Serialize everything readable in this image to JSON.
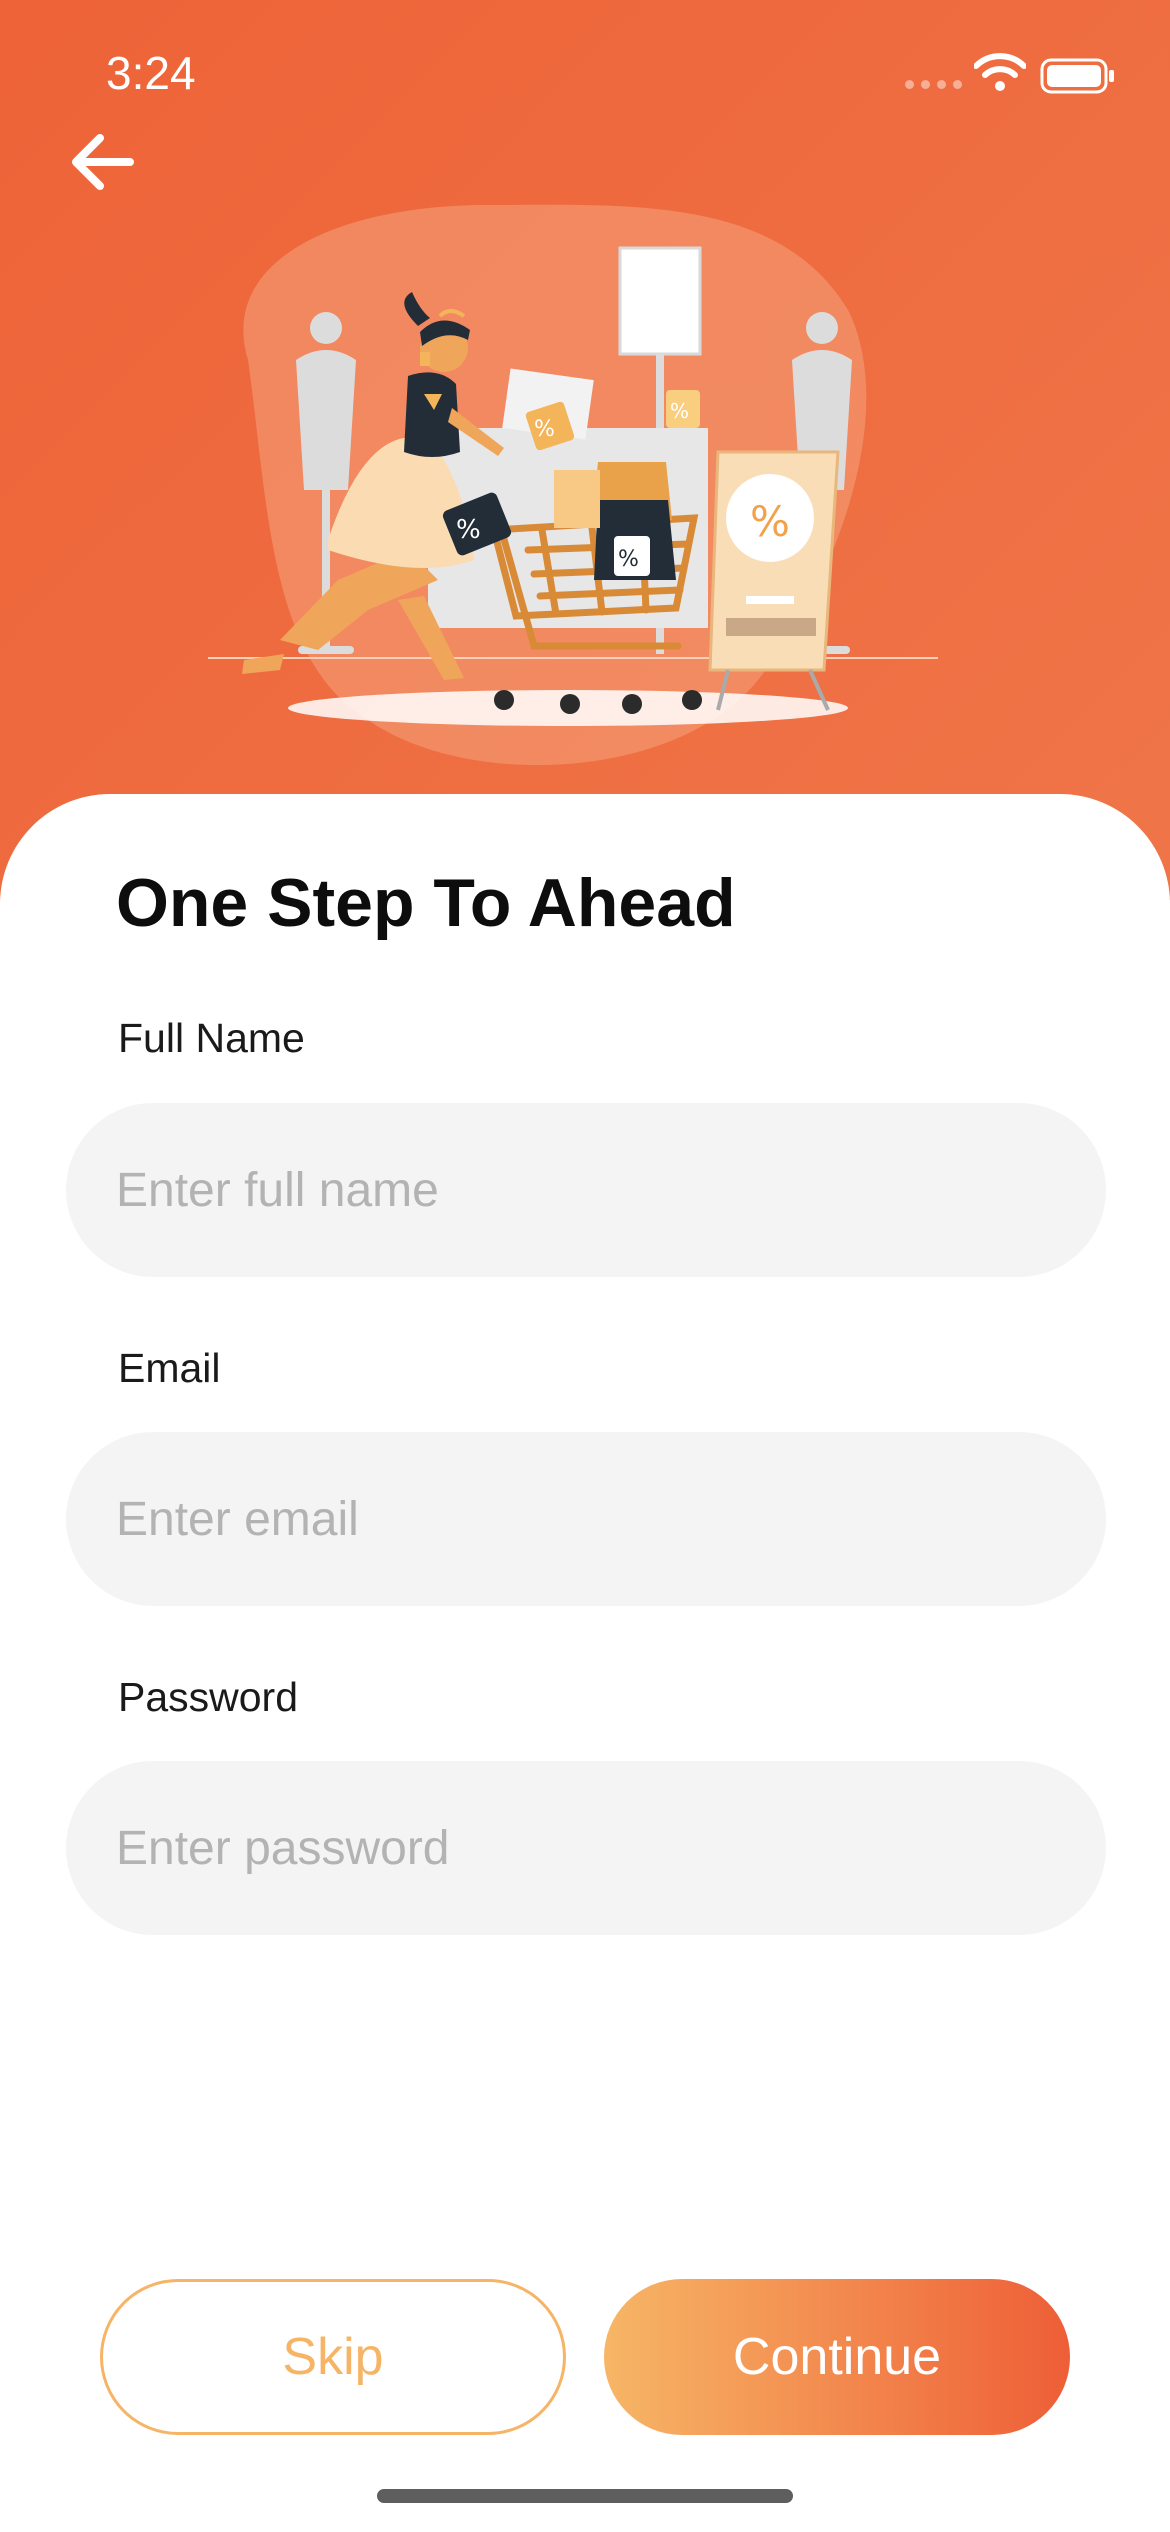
{
  "status_bar": {
    "time": "3:24"
  },
  "header": {
    "back_icon": "arrow-left-icon"
  },
  "illustration": {
    "name": "shopping-woman-cart-illustration",
    "sale_symbol": "%"
  },
  "form": {
    "title": "One Step To Ahead",
    "full_name": {
      "label": "Full Name",
      "placeholder": "Enter full name"
    },
    "email": {
      "label": "Email",
      "placeholder": "Enter email"
    },
    "password": {
      "label": "Password",
      "placeholder": "Enter password"
    }
  },
  "actions": {
    "skip_label": "Skip",
    "continue_label": "Continue"
  },
  "colors": {
    "hero_bg": "#ee6338",
    "accent_light": "#f6b467",
    "field_bg": "#f4f4f4",
    "placeholder": "#b3b3b3"
  }
}
